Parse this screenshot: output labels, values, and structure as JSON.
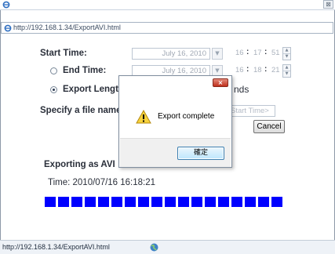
{
  "browser": {
    "address_url": "http://192.168.1.34/ExportAVI.html",
    "status_url": "http://192.168.1.34/ExportAVI.html",
    "close_glyph": "⊠"
  },
  "form": {
    "start_time_label": "Start Time:",
    "start_date": "July 16, 2010",
    "start_hh": "16",
    "start_mm": "17",
    "start_ss": "51",
    "end_time_label": "End Time:",
    "end_date": "July 16, 2010",
    "end_hh": "16",
    "end_mm": "18",
    "end_ss": "21",
    "export_length_label": "Export Lengt",
    "export_length_suffix": "nds",
    "filename_label": "Specify a file name",
    "filename_placeholder": "Start Time>",
    "cancel_label": "Cancel",
    "time_sep": ":",
    "end_time_selected": false,
    "export_length_selected": true
  },
  "status": {
    "exporting_label": "Exporting as AVI",
    "time_text": "Time: 2010/07/16 16:18:21",
    "progress_cells": 18,
    "progress_color": "#0000ff"
  },
  "dialog": {
    "close_glyph": "×",
    "message": "Export complete",
    "ok_label": "確定",
    "icon": "warning-icon"
  }
}
